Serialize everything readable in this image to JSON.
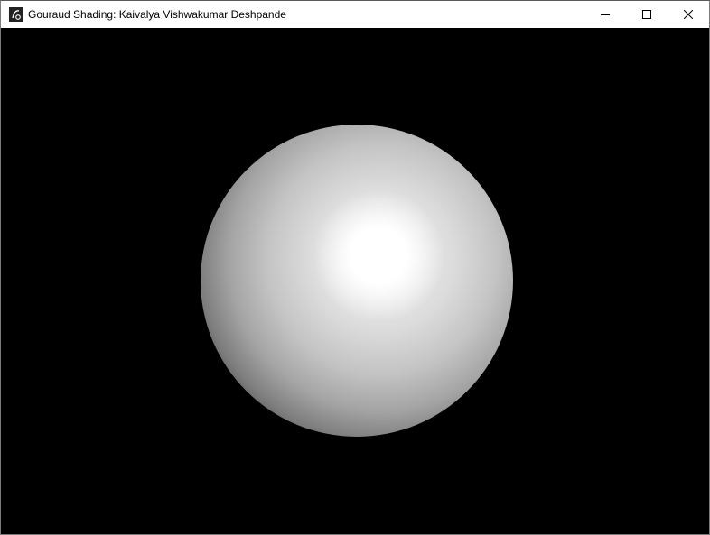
{
  "window": {
    "title": "Gouraud Shading: Kaivalya Vishwakumar Deshpande",
    "app_icon": "app-icon",
    "controls": {
      "minimize_icon": "minimize-icon",
      "maximize_icon": "maximize-icon",
      "close_icon": "close-icon"
    }
  },
  "scene": {
    "background_color": "#000000",
    "object": "sphere",
    "object_color": "#ffffff",
    "shading": "gouraud"
  }
}
